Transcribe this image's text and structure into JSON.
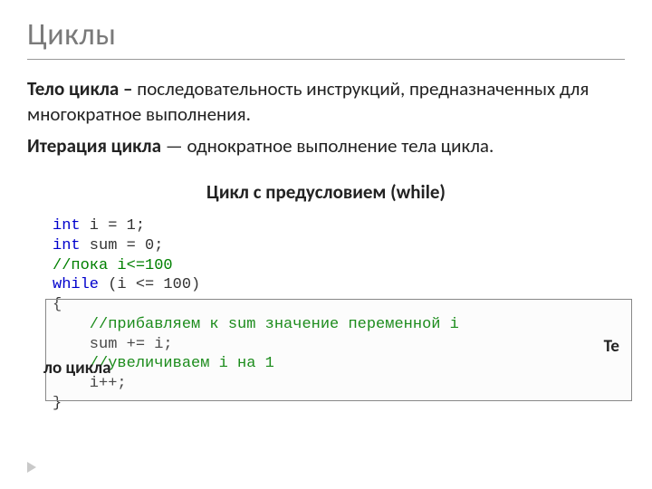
{
  "title": "Циклы",
  "paragraphs": {
    "p1_bold": "Тело цикла – ",
    "p1_rest": "последовательность инструкций, предназначенных для многократное выполнения.",
    "p2_bold": "Итерация цикла ",
    "p2_rest": "— однократное выполнение тела цикла."
  },
  "subtitle": "Цикл с предусловием (while)",
  "code": {
    "l1_kw": "int",
    "l1_rest": " i = 1;",
    "l2_kw": "int",
    "l2_rest": " sum = 0;",
    "l3": "//пока i<=100",
    "l4_kw": "while",
    "l4_rest": " (i <= 100)",
    "l5": "{",
    "l6": "    //прибавляем к sum значение переменной i",
    "l7": "    sum += i;",
    "l8": "    //увеличиваем i на 1",
    "l9": "    i++;",
    "l10": "}"
  },
  "overlay": {
    "right": "Те",
    "left": "ло цикла"
  }
}
